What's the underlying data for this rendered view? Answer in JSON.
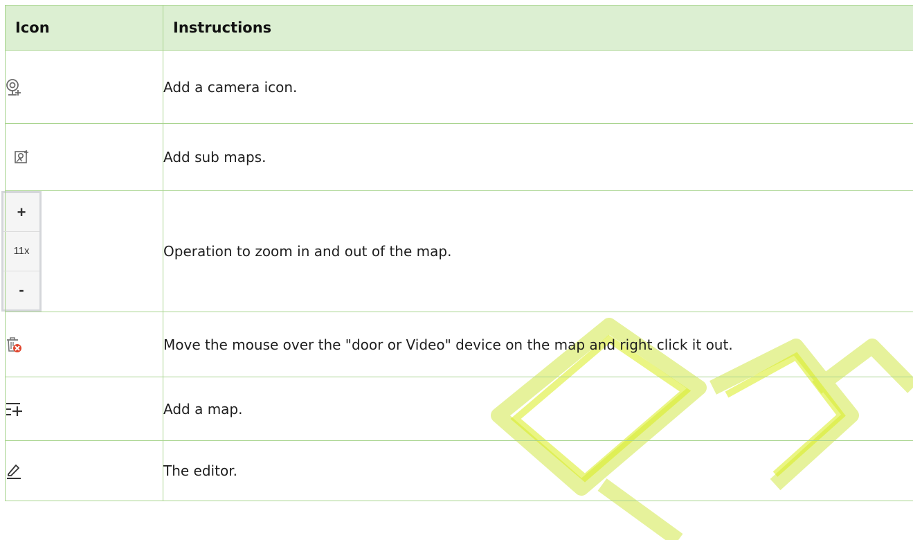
{
  "table": {
    "headers": {
      "icon": "Icon",
      "instructions": "Instructions"
    },
    "rows": [
      {
        "icon": "add-camera-icon",
        "text": "Add a camera icon."
      },
      {
        "icon": "add-sub-map-icon",
        "text": "Add sub maps."
      },
      {
        "icon": "zoom-control",
        "text": "Operation to zoom in and out of the map."
      },
      {
        "icon": "delete-device-icon",
        "text": "Move the mouse over the \"door or Video\" device on the map and right click it out."
      },
      {
        "icon": "add-map-icon",
        "text": "Add a map."
      },
      {
        "icon": "edit-icon",
        "text": "The editor."
      }
    ]
  },
  "zoom": {
    "plus": "+",
    "level": "11x",
    "minus": "-"
  },
  "colors": {
    "border": "#a6d38c",
    "header_bg": "#dcefd2",
    "watermark": "#d9ec1e"
  }
}
